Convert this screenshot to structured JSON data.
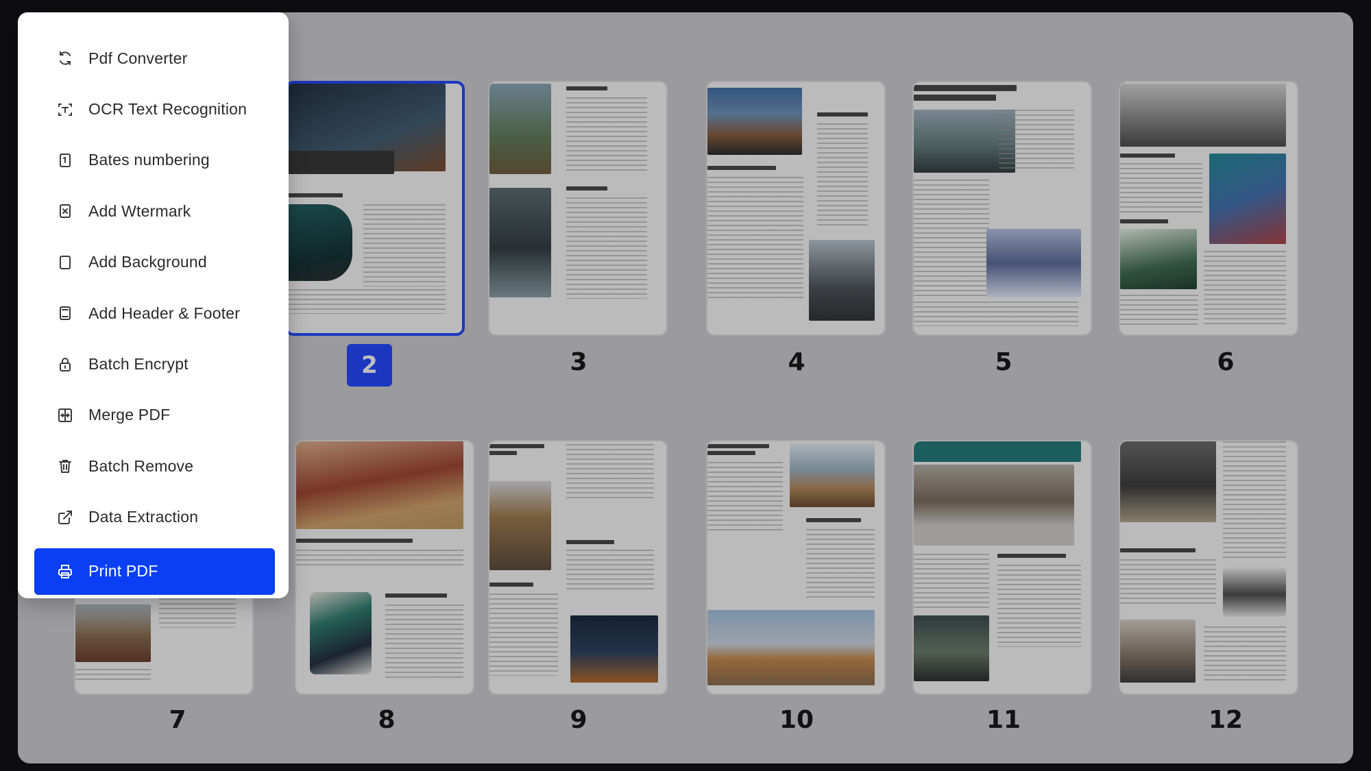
{
  "menu": {
    "items": [
      {
        "label": "Pdf Converter",
        "icon": "convert-icon"
      },
      {
        "label": "OCR Text Recognition",
        "icon": "ocr-icon"
      },
      {
        "label": "Bates numbering",
        "icon": "bates-icon"
      },
      {
        "label": "Add Wtermark",
        "icon": "watermark-icon"
      },
      {
        "label": "Add Background",
        "icon": "background-icon"
      },
      {
        "label": "Add Header & Footer",
        "icon": "header-footer-icon"
      },
      {
        "label": "Batch Encrypt",
        "icon": "lock-icon"
      },
      {
        "label": "Merge PDF",
        "icon": "merge-icon"
      },
      {
        "label": "Batch Remove",
        "icon": "trash-icon"
      },
      {
        "label": "Data Extraction",
        "icon": "external-link-icon"
      }
    ],
    "active_item": {
      "label": "Print PDF",
      "icon": "printer-icon"
    }
  },
  "pages": [
    {
      "number": "2",
      "selected": true
    },
    {
      "number": "3"
    },
    {
      "number": "4"
    },
    {
      "number": "5"
    },
    {
      "number": "6"
    },
    {
      "number": "7"
    },
    {
      "number": "8"
    },
    {
      "number": "9"
    },
    {
      "number": "10"
    },
    {
      "number": "11"
    },
    {
      "number": "12"
    }
  ],
  "colors": {
    "accent": "#0b3ff5",
    "selected_border": "#1e44ff"
  }
}
